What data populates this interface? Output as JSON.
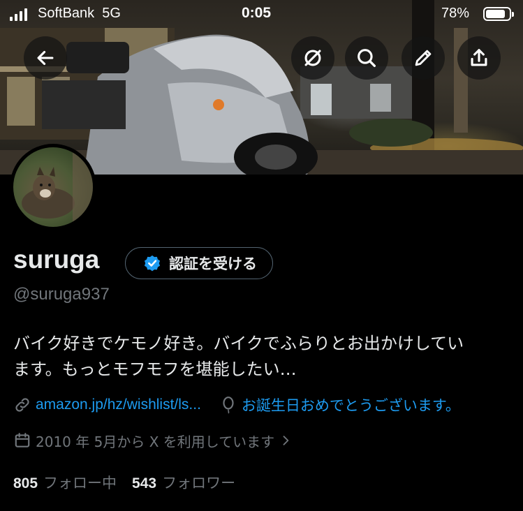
{
  "status_bar": {
    "carrier": "SoftBank",
    "network": "5G",
    "time": "0:05",
    "battery_percent": "78%",
    "battery_level": 0.78
  },
  "header": {
    "buttons": [
      {
        "name": "back",
        "icon": "arrow-left-icon"
      },
      {
        "name": "grok",
        "icon": "grok-slash-icon"
      },
      {
        "name": "search",
        "icon": "search-icon"
      },
      {
        "name": "edit",
        "icon": "pencil-icon"
      },
      {
        "name": "share",
        "icon": "share-icon"
      }
    ]
  },
  "profile": {
    "display_name": "suruga",
    "verify_label": "認証を受ける",
    "handle": "@suruga937",
    "bio_line1": "バイク好きでケモノ好き。バイクでふらりとお出かけしてい",
    "bio_line2": "ます。もっとモフモフを堪能したい…",
    "link": "amazon.jp/hz/wishlist/ls...",
    "birthday": "お誕生日おめでとうございます。",
    "joined": "2010 年 5月から X を利用しています",
    "following_count": "805",
    "following_label": "フォロー中",
    "followers_count": "543",
    "followers_label": "フォロワー"
  },
  "colors": {
    "accent": "#1d9bf0",
    "muted": "#71767b",
    "text": "#e7e9ea",
    "background": "#000000"
  }
}
